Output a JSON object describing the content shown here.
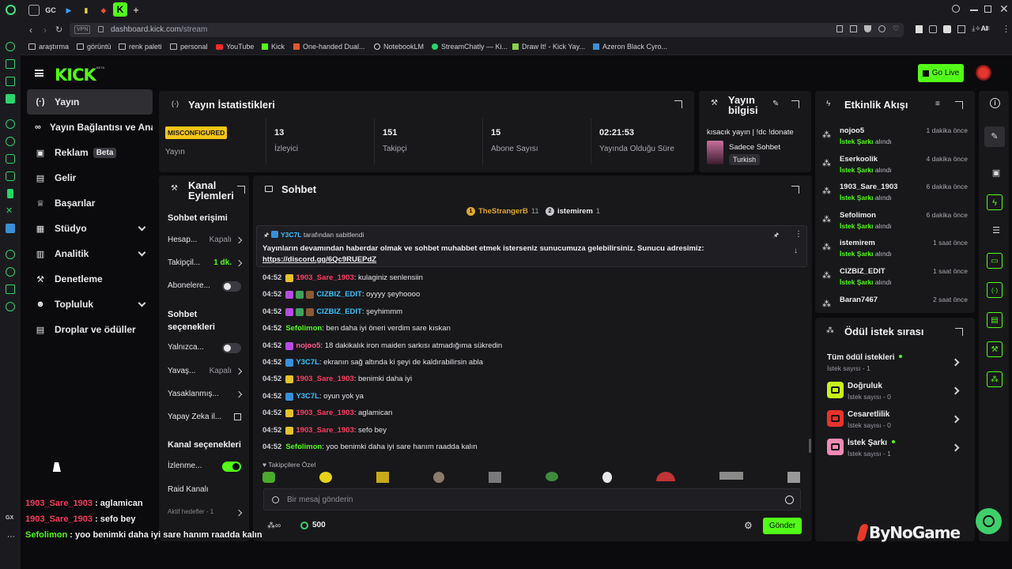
{
  "browser": {
    "url_host": "dashboard.kick.com",
    "url_path": "/stream",
    "vpn_label": "VPN",
    "tab_labels": [
      "GC"
    ],
    "ai_label": "AI",
    "bookmarks": [
      "araştırma",
      "görüntü",
      "renk paleti",
      "personal",
      "YouTube",
      "Kick",
      "One-handed Dual...",
      "NotebookLM",
      "StreamChatly — Ki...",
      "Draw It! - Kick Yay...",
      "Azeron Black Cyro..."
    ]
  },
  "header": {
    "logo_text": "KICK",
    "logo_beta": "BETA",
    "go_live_label": "Go Live"
  },
  "sidebar": {
    "items": [
      {
        "label": "Yayın",
        "icon": "broadcast-icon"
      },
      {
        "label": "Yayın Bağlantısı ve Anahtar",
        "icon": "link-icon"
      },
      {
        "label": "Reklam",
        "badge": "Beta",
        "icon": "ad-icon"
      },
      {
        "label": "Gelir",
        "icon": "revenue-icon"
      },
      {
        "label": "Başarılar",
        "icon": "trophy-icon"
      },
      {
        "label": "Stüdyo",
        "icon": "studio-icon"
      },
      {
        "label": "Analitik",
        "icon": "analytics-icon"
      },
      {
        "label": "Denetleme",
        "icon": "wrench-icon"
      },
      {
        "label": "Topluluk",
        "icon": "community-icon"
      },
      {
        "label": "Droplar ve ödüller",
        "icon": "gift-icon"
      }
    ]
  },
  "stats": {
    "title": "Yayın İstatistikleri",
    "status_badge": "MISCONFIGURED",
    "status_label": "Yayın",
    "cols": [
      {
        "value": "13",
        "label": "İzleyici"
      },
      {
        "value": "151",
        "label": "Takipçi"
      },
      {
        "value": "15",
        "label": "Abone Sayısı"
      },
      {
        "value": "02:21:53",
        "label": "Yayında Olduğu Süre"
      }
    ]
  },
  "info": {
    "title_line1": "Yayın",
    "title_line2": "bilgisi",
    "stream_title": "kısacık yayın | !dc !donate",
    "category": "Sadece Sohbet",
    "language": "Turkish"
  },
  "actions": {
    "title_line1": "Kanal",
    "title_line2": "Eylemleri",
    "chat_access_title": "Sohbet erişimi",
    "chat_access": [
      {
        "label": "Hesap...",
        "value": "Kapalı",
        "type": "chevron"
      },
      {
        "label": "Takipçil...",
        "value": "1 dk.",
        "type": "chevron",
        "value_green": true
      },
      {
        "label": "Abonelere...",
        "type": "toggle",
        "on": false
      }
    ],
    "chat_options_title_line1": "Sohbet",
    "chat_options_title_line2": "seçenekleri",
    "chat_options": [
      {
        "label": "Yalnızca...",
        "type": "toggle",
        "on": false
      },
      {
        "label": "Yavaş...",
        "value": "Kapalı",
        "type": "chevron"
      },
      {
        "label": "Yasaklanmış...",
        "type": "chevron"
      },
      {
        "label": "Yapay Zeka il...",
        "type": "external"
      }
    ],
    "channel_options_title": "Kanal seçenekleri",
    "channel_options": [
      {
        "label": "İzlenme...",
        "type": "toggle",
        "on": true
      },
      {
        "label": "Raid Kanalı",
        "type": "none"
      },
      {
        "label": "Aktif hedefler - 1",
        "type": "chevron"
      }
    ]
  },
  "chat": {
    "title": "Sohbet",
    "top_gifters": [
      {
        "rank": "1",
        "name": "TheStrangerB",
        "count": "11"
      },
      {
        "rank": "2",
        "name": "istemirem",
        "count": "1"
      }
    ],
    "pinned": {
      "by_user": "Y3C7L",
      "by_suffix": "tarafından sabitlendi",
      "text": "Yayınların devamından haberdar olmak ve sohbet muhabbet etmek isterseniz sunucumuza gelebilirsiniz. Sunucu adresimiz:",
      "link": "https://discord.gg/6Qc9RUEPdZ"
    },
    "messages": [
      {
        "time": "04:52",
        "user": "1903_Sare_1903",
        "color": "#ff3d63",
        "badges": [
          "#e6c229"
        ],
        "text": ": kulaginiz senlensiin"
      },
      {
        "time": "04:52",
        "user": "CIZBIZ_EDIT",
        "color": "#36c3ff",
        "badges": [
          "#b84ce0",
          "#3fa35b",
          "#8a5a34"
        ],
        "text": ": oyyyy şeyhoooo"
      },
      {
        "time": "04:52",
        "user": "CIZBIZ_EDIT",
        "color": "#36c3ff",
        "badges": [
          "#b84ce0",
          "#3fa35b",
          "#8a5a34"
        ],
        "text": ": şeyhimmm"
      },
      {
        "time": "04:52",
        "user": "Sefolimon",
        "color": "#53fc18",
        "badges": [],
        "text": ": ben daha iyi öneri verdim sare kıskan"
      },
      {
        "time": "04:52",
        "user": "nojoo5",
        "color": "#ff5c8a",
        "badges": [
          "#b84ce0"
        ],
        "text": ": 18 dakikalık iron maiden sarkısı atmadığıma sükredin"
      },
      {
        "time": "04:52",
        "user": "Y3C7L",
        "color": "#36c3ff",
        "badges": [
          "#3a8fd9"
        ],
        "text": ": ekranın sağ altında ki şeyi de kaldırabilirsin abla"
      },
      {
        "time": "04:52",
        "user": "1903_Sare_1903",
        "color": "#ff3d63",
        "badges": [
          "#e6c229"
        ],
        "text": ": benimki daha iyi"
      },
      {
        "time": "04:52",
        "user": "Y3C7L",
        "color": "#36c3ff",
        "badges": [
          "#3a8fd9"
        ],
        "text": ": oyun yok ya"
      },
      {
        "time": "04:52",
        "user": "1903_Sare_1903",
        "color": "#ff3d63",
        "badges": [
          "#e6c229"
        ],
        "text": ": aglamican"
      },
      {
        "time": "04:52",
        "user": "1903_Sare_1903",
        "color": "#ff3d63",
        "badges": [
          "#e6c229"
        ],
        "text": ": sefo bey"
      },
      {
        "time": "04:52",
        "user": "Sefolimon",
        "color": "#53fc18",
        "badges": [],
        "text": ": yoo benimki daha iyi sare hanım raadda kalın"
      }
    ],
    "followers_only_label": "Takipçilere Özel",
    "input_placeholder": "Bir mesaj gönderin",
    "points_value": "500",
    "send_label": "Gönder"
  },
  "events": {
    "title": "Etkinlik Akışı",
    "items": [
      {
        "user": "nojoo5",
        "time": "1 dakika önce",
        "reward": "İstek Şarkı",
        "suffix": "alındı"
      },
      {
        "user": "Eserkoolik",
        "time": "4 dakika önce",
        "reward": "İstek Şarkı",
        "suffix": "alındı"
      },
      {
        "user": "1903_Sare_1903",
        "time": "6 dakika önce",
        "reward": "İstek Şarkı",
        "suffix": "alındı"
      },
      {
        "user": "Sefolimon",
        "time": "6 dakika önce",
        "reward": "İstek Şarkı",
        "suffix": "alındı"
      },
      {
        "user": "istemirem",
        "time": "1 saat önce",
        "reward": "İstek Şarkı",
        "suffix": "alındı"
      },
      {
        "user": "CIZBIZ_EDIT",
        "time": "1 saat önce",
        "reward": "İstek Şarkı",
        "suffix": "alındı"
      },
      {
        "user": "Baran7467",
        "time": "2 saat önce",
        "reward": "İstek Şarkı",
        "suffix": "alındı"
      }
    ]
  },
  "rewards": {
    "title": "Ödül istek sırası",
    "items": [
      {
        "name": "Tüm ödül istekleri",
        "sub": "İstek sayısı - 1",
        "color": "",
        "dot": true
      },
      {
        "name": "Doğruluk",
        "sub": "İstek sayısı - 0",
        "color": "#c8f21a",
        "dot": false
      },
      {
        "name": "Cesaretlilik",
        "sub": "İstek sayısı - 0",
        "color": "#e8332c",
        "dot": false
      },
      {
        "name": "İstek Şarkı",
        "sub": "İstek sayısı - 1",
        "color": "#f28ab6",
        "dot": true
      }
    ]
  },
  "overlay": {
    "lines": [
      {
        "user": "1903_Sare_1903",
        "color": "#ff3d63",
        "text": " : aglamican"
      },
      {
        "user": "1903_Sare_1903",
        "color": "#ff3d63",
        "text": " : sefo bey"
      },
      {
        "user": "Sefolimon",
        "color": "#53fc18",
        "text": " : yoo benimki daha iyi sare hanım raadda kalın"
      }
    ],
    "watermark": "ByNoGame"
  },
  "colors": {
    "accent": "#53fc18",
    "panel": "#18181b",
    "bg": "#0b0b0d",
    "warn": "#f5c518"
  }
}
